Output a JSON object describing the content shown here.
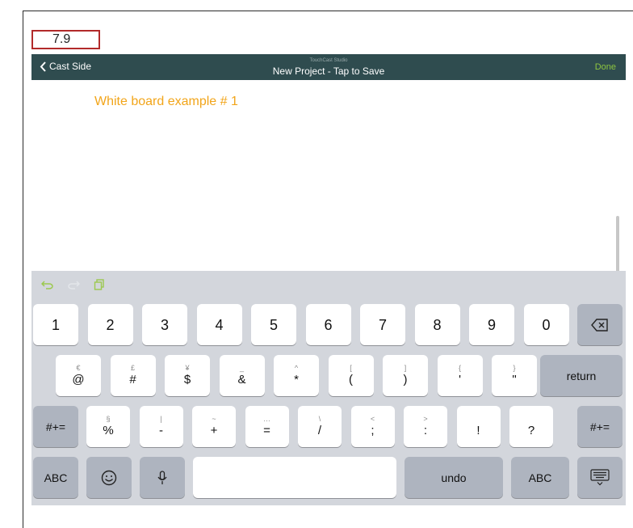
{
  "step_badge": "7.9",
  "navbar": {
    "back_label": "Cast Side",
    "subtitle": "TouchCast Studio",
    "title": "New Project - Tap to Save",
    "done_label": "Done"
  },
  "board": {
    "text": "White board example # 1"
  },
  "keyboard": {
    "toolbar": [
      "undo-icon",
      "redo-icon",
      "paste-icon"
    ],
    "row1": [
      "1",
      "2",
      "3",
      "4",
      "5",
      "6",
      "7",
      "8",
      "9",
      "0"
    ],
    "row2": [
      {
        "hint": "€",
        "main": "@"
      },
      {
        "hint": "£",
        "main": "#"
      },
      {
        "hint": "¥",
        "main": "$"
      },
      {
        "hint": "_",
        "main": "&"
      },
      {
        "hint": "^",
        "main": "*"
      },
      {
        "hint": "[",
        "main": "("
      },
      {
        "hint": "]",
        "main": ")"
      },
      {
        "hint": "{",
        "main": "'"
      },
      {
        "hint": "}",
        "main": "\""
      }
    ],
    "return_label": "return",
    "row3": [
      {
        "hint": "§",
        "main": "%"
      },
      {
        "hint": "|",
        "main": "-"
      },
      {
        "hint": "~",
        "main": "+"
      },
      {
        "hint": "…",
        "main": "="
      },
      {
        "hint": "\\",
        "main": "/"
      },
      {
        "hint": "<",
        "main": ";"
      },
      {
        "hint": ">",
        "main": ":"
      },
      {
        "hint": "",
        "main": "!"
      },
      {
        "hint": "",
        "main": "?"
      }
    ],
    "row3_bottom": [
      "",
      "",
      "",
      "",
      "",
      "",
      "",
      ",",
      "."
    ],
    "symbols_label": "#+=",
    "abc_label": "ABC",
    "undo_label": "undo",
    "space_label": ""
  }
}
